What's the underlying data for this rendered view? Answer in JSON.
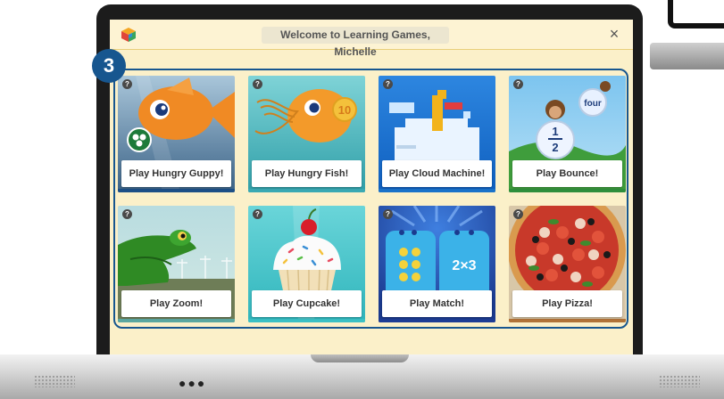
{
  "window": {
    "title": "Welcome to Learning Games, Michelle",
    "close_icon": "×"
  },
  "step_badge": "3",
  "games": [
    {
      "label": "Play Hungry Guppy!",
      "icon": "guppy-fish-icon",
      "color": "#1d4f86"
    },
    {
      "label": "Play Hungry Fish!",
      "icon": "fish-number-icon",
      "color": "#3aa9b3"
    },
    {
      "label": "Play Cloud Machine!",
      "icon": "cloud-machine-icon",
      "color": "#1a72c9"
    },
    {
      "label": "Play Bounce!",
      "icon": "monkey-fraction-icon",
      "color": "#2f8f3c"
    },
    {
      "label": "Play Zoom!",
      "icon": "frog-icon",
      "color": "#5ba7a0"
    },
    {
      "label": "Play Cupcake!",
      "icon": "cupcake-icon",
      "color": "#3bc0c4"
    },
    {
      "label": "Play Match!",
      "icon": "match-cards-icon",
      "color": "#1d3c95"
    },
    {
      "label": "Play Pizza!",
      "icon": "pizza-icon",
      "color": "#b07238"
    }
  ],
  "scene_text": {
    "hungry_fish_number": "10",
    "bounce_word": "four",
    "bounce_fraction_num": "1",
    "bounce_fraction_den": "2",
    "match_expression": "2×3"
  },
  "help_glyph": "?",
  "base_dots": "●●●"
}
